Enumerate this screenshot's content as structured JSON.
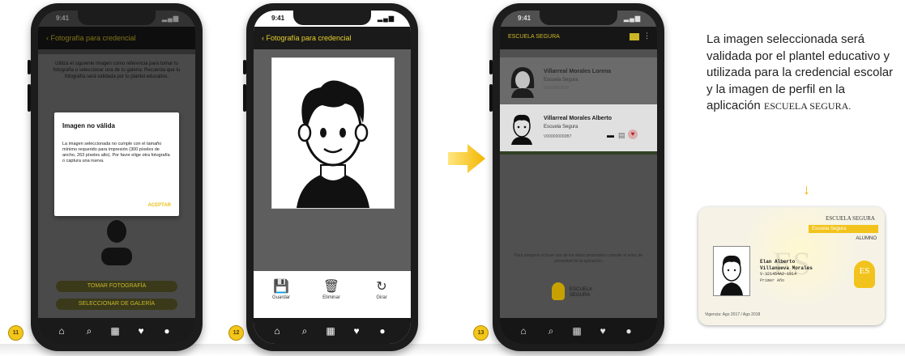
{
  "phone1": {
    "status_time": "9:41",
    "header_title": "‹  Fotografía para credencial",
    "instructions": "Utiliza el siguiente imagen como referencia para tomar tu fotografía o seleccionar una de tu galería. Recuerda que tu fotografía será validada por tu plantel educativo.",
    "modal_title": "Imagen no válida",
    "modal_body": "La imagen seleccionada no cumple con el tamaño mínimo requerido para impresión (300 píxeles de ancho, 263 píxeles alto). Por favor elige otra fotografía o captura una nueva.",
    "modal_action": "ACEPTAR",
    "button_take_photo": "TOMAR FOTOGRAFÍA",
    "button_gallery": "SELECCIONAR DE GALERÍA",
    "step": "11"
  },
  "phone2": {
    "status_time": "9:41",
    "header_title": "‹  Fotografía para credencial",
    "tools": [
      {
        "icon": "save-icon",
        "label": "Guardar"
      },
      {
        "icon": "trash-icon",
        "label": "Eliminar"
      },
      {
        "icon": "rotate-icon",
        "label": "Girar"
      }
    ],
    "step": "12"
  },
  "phone3": {
    "status_time": "9:41",
    "header_title": "ESCUELA SEGURA",
    "cards": [
      {
        "name": "Villarreal Morales Lorena",
        "school": "Escuela Segura",
        "id": "V0000000000"
      },
      {
        "name": "Villarreal Morales Alberto",
        "school": "Escuela Segura",
        "id": "V000000000B7"
      }
    ],
    "footer_text": "Para asegurar el buen uso de los datos personales consulte el aviso de privacidad de la aplicación.",
    "logo_text": "ESCUELA SEGURA",
    "step": "13"
  },
  "description": {
    "text": "La imagen seleccionada será validada por el plantel educativo y utilizada para la credencial escolar y la imagen de perfil en la aplicación",
    "brand": "ESCUELA SEGURA."
  },
  "idcard": {
    "brand": "ESCUELA SEGURA",
    "school": "Escuela Segura",
    "role": "ALUMNO",
    "name1": "Elan Alberto",
    "name2": "Villanueva Morales",
    "id": "V-321454A2-1914",
    "grade": "Primer Año",
    "validity": "Vigencia: Ago 2017 / Ago 2018"
  }
}
